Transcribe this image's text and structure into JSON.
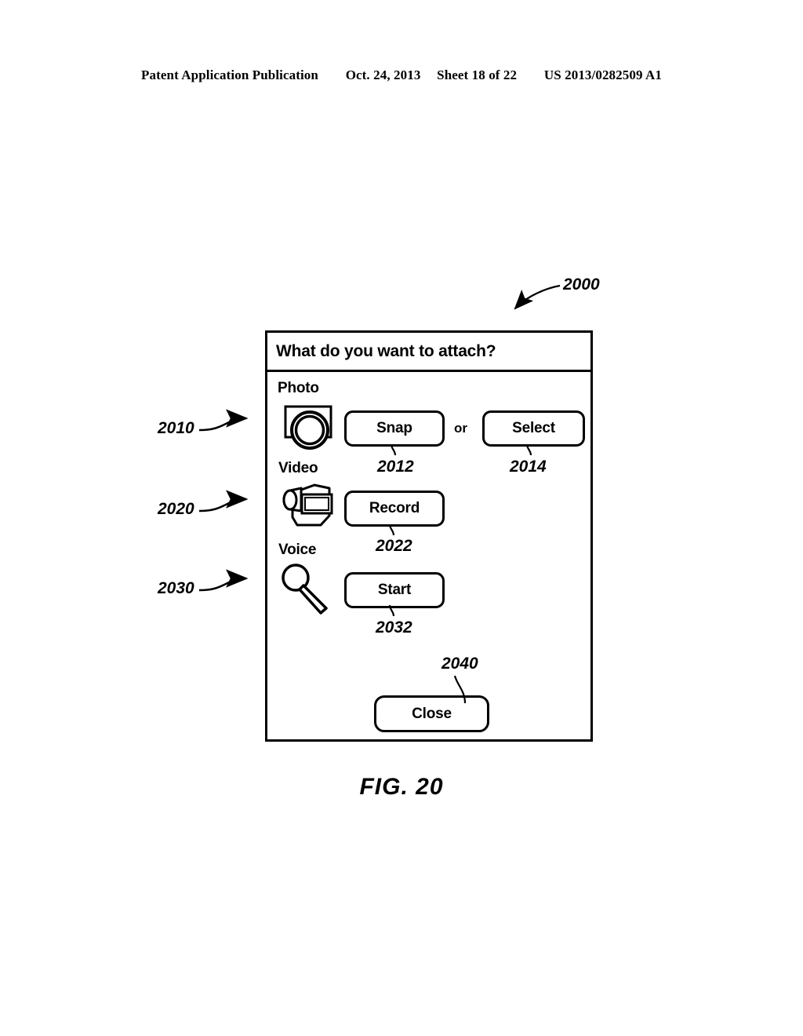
{
  "header": {
    "publication": "Patent Application Publication",
    "date": "Oct. 24, 2013",
    "sheet": "Sheet 18 of 22",
    "patent_number": "US 2013/0282509 A1"
  },
  "figure": {
    "caption": "FIG. 20",
    "reference": "2000"
  },
  "dialog": {
    "title": "What do you want to attach?",
    "sections": [
      {
        "label": "Photo",
        "icon": "camera-icon",
        "reference": "2010"
      },
      {
        "label": "Video",
        "icon": "camcorder-icon",
        "reference": "2020"
      },
      {
        "label": "Voice",
        "icon": "microphone-icon",
        "reference": "2030"
      }
    ],
    "buttons": {
      "snap": {
        "label": "Snap",
        "reference": "2012"
      },
      "select": {
        "label": "Select",
        "reference": "2014"
      },
      "record": {
        "label": "Record",
        "reference": "2022"
      },
      "start": {
        "label": "Start",
        "reference": "2032"
      },
      "close": {
        "label": "Close",
        "reference": "2040"
      }
    },
    "conjunction": "or"
  },
  "colors": {
    "ink": "#000000",
    "paper": "#ffffff"
  }
}
